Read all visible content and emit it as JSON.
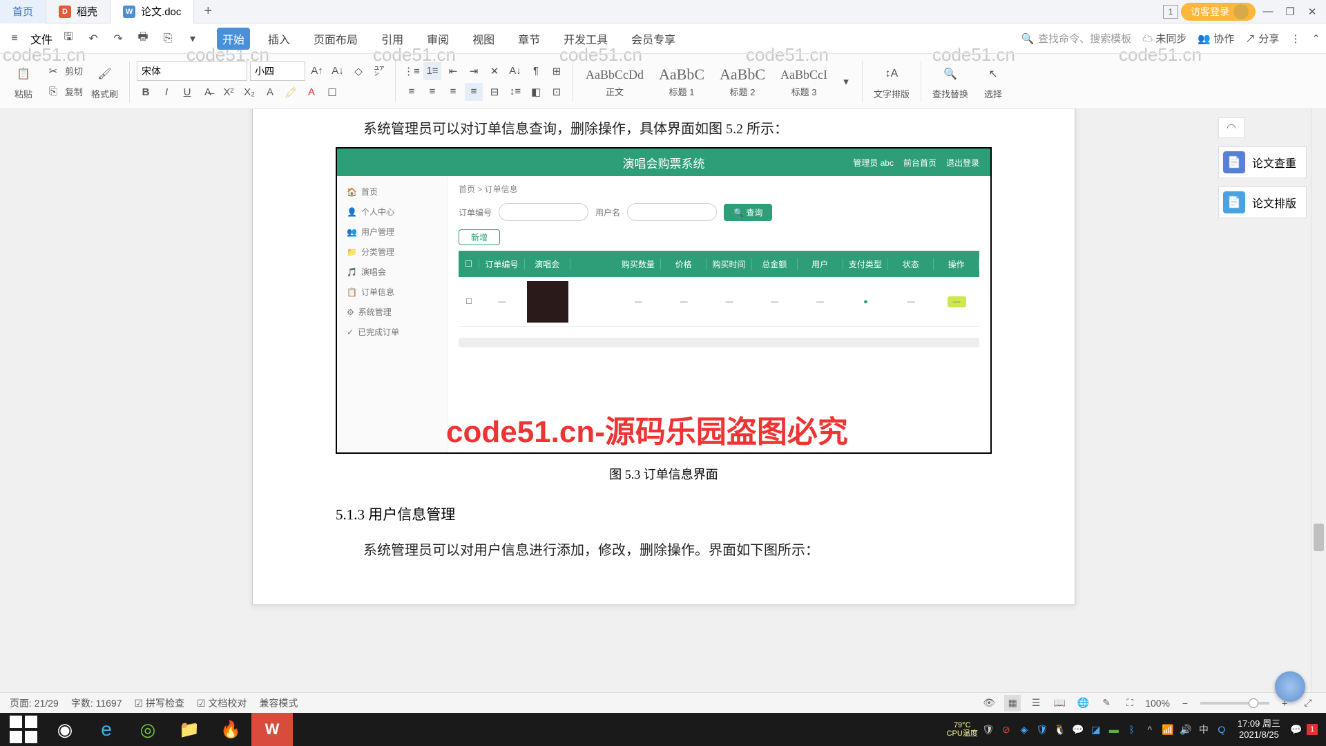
{
  "tabs": {
    "home": "首页",
    "dk": "稻壳",
    "doc": "论文.doc"
  },
  "login": "访客登录",
  "file_menu": "文件",
  "menus": {
    "start": "开始",
    "insert": "插入",
    "layout": "页面布局",
    "ref": "引用",
    "review": "审阅",
    "view": "视图",
    "chapter": "章节",
    "dev": "开发工具",
    "vip": "会员专享"
  },
  "search_ph": "查找命令、搜索模板",
  "sync": "未同步",
  "collab": "协作",
  "share": "分享",
  "ribbon": {
    "paste": "粘贴",
    "cut": "剪切",
    "copy": "复制",
    "brush": "格式刷",
    "font": "宋体",
    "size": "小四",
    "body": "正文",
    "h1": "标题 1",
    "h2": "标题 2",
    "h3": "标题 3",
    "textdir": "文字排版",
    "find": "查找替换",
    "select": "选择"
  },
  "doc": {
    "line0": "系统管理员可以对订单信息查询，删除操作，具体界面如图 5.2 所示：",
    "app_title": "演唱会购票系统",
    "app_hr1": "管理员 abc",
    "app_hr2": "前台首页",
    "app_hr3": "退出登录",
    "side": [
      "首页",
      "个人中心",
      "用户管理",
      "分类管理",
      "演唱会",
      "订单信息",
      "系统管理",
      "已完成订单"
    ],
    "bc": "首页 > 订单信息",
    "f1": "订单编号",
    "f2": "用户名",
    "fbtn": "查询",
    "add": "新增",
    "th": [
      "",
      "订单编号",
      "演唱会",
      "",
      "购买数量",
      "价格",
      "购买时间",
      "总金额",
      "用户",
      "支付类型",
      "状态",
      "操作"
    ],
    "red": "code51.cn-源码乐园盗图必究",
    "caption": "图 5.3  订单信息界面",
    "sec": "5.1.3  用户信息管理",
    "para": "系统管理员可以对用户信息进行添加，修改，删除操作。界面如下图所示："
  },
  "side_panel": {
    "check": "论文查重",
    "format": "论文排版"
  },
  "status": {
    "page": "页面: 21/29",
    "words": "字数: 11697",
    "spell": "拼写检查",
    "proof": "文档校对",
    "compat": "兼容模式",
    "zoom": "100%",
    "cpu": "CPU温度",
    "temp": "79°C"
  },
  "tray": {
    "ime": "中",
    "time": "17:09 周三",
    "date": "2021/8/25"
  },
  "wm": "code51.cn"
}
